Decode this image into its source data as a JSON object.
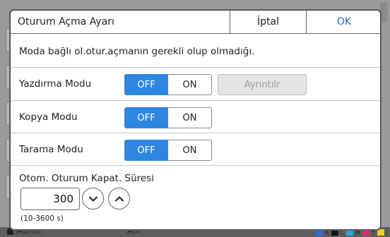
{
  "dialog": {
    "title": "Oturum Açma Ayarı",
    "cancel_label": "İptal",
    "ok_label": "OK",
    "description": "Moda bağlı ol.otur.açmanın gerekli olup olmadığı."
  },
  "modes": [
    {
      "label": "Yazdırma Modu",
      "off_label": "OFF",
      "on_label": "ON",
      "selected": "OFF",
      "details_label": "Ayrıntılr"
    },
    {
      "label": "Kopya Modu",
      "off_label": "OFF",
      "on_label": "ON",
      "selected": "OFF"
    },
    {
      "label": "Tarama Modu",
      "off_label": "OFF",
      "on_label": "ON",
      "selected": "OFF"
    }
  ],
  "timeout": {
    "label": "Otom. Oturum Kapat. Süresi",
    "value": "300",
    "range": "(10-3600 s)"
  },
  "background": {
    "user": "Admin",
    "center_text": "Atıl"
  },
  "colors": {
    "accent": "#2f86e0",
    "ok_text": "#1f6fc5"
  }
}
